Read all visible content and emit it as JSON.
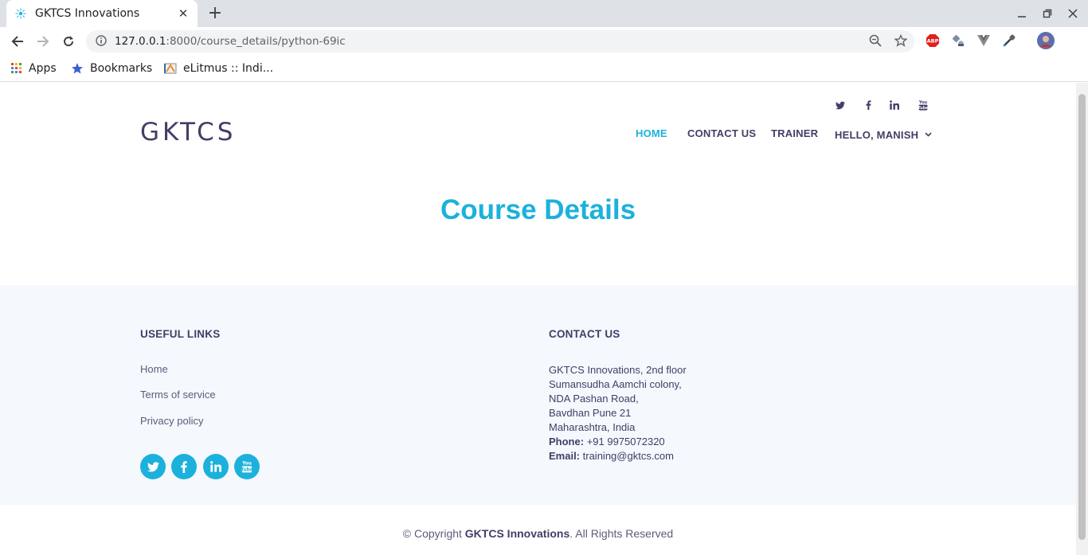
{
  "browser": {
    "tab_title": "GKTCS Innovations",
    "url_host": "127.0.0.1",
    "url_path": ":8000/course_details/python-69ic",
    "bookmarks": [
      {
        "label": "Apps",
        "icon": "apps-grid-icon"
      },
      {
        "label": "Bookmarks",
        "icon": "star-icon"
      },
      {
        "label": "eLitmus :: Indi...",
        "icon": "elitmus-favicon"
      }
    ],
    "extensions": [
      "adblock-icon",
      "satellite-icon",
      "vue-devtools-icon",
      "eyedropper-icon",
      "profile-avatar"
    ]
  },
  "header": {
    "logo": "GKTCS",
    "social": [
      "twitter-icon",
      "facebook-icon",
      "linkedin-icon",
      "youtube-icon"
    ],
    "nav": [
      {
        "label": "HOME",
        "active": true
      },
      {
        "label": "CONTACT US",
        "active": false
      },
      {
        "label": "TRAINER",
        "active": false
      },
      {
        "label": "HELLO, MANISH",
        "active": false,
        "dropdown": true
      }
    ]
  },
  "main": {
    "title": "Course Details"
  },
  "footer": {
    "useful_links_heading": "USEFUL LINKS",
    "links": [
      "Home",
      "Terms of service",
      "Privacy policy"
    ],
    "contact_heading": "CONTACT US",
    "address_lines": [
      "GKTCS Innovations, 2nd floor",
      "Sumansudha Aamchi colony,",
      "NDA Pashan Road,",
      "Bavdhan Pune 21",
      "Maharashtra, India"
    ],
    "phone_label": "Phone:",
    "phone": "+91 9975072320",
    "email_label": "Email:",
    "email": "training@gktcs.com",
    "copyright_prefix": "© Copyright",
    "copyright_brand": "GKTCS Innovations",
    "copyright_suffix": ". All Rights Reserved"
  },
  "colors": {
    "accent": "#1bb1dc",
    "primary_text": "#413e66",
    "footer_bg": "#f5f8fd"
  }
}
